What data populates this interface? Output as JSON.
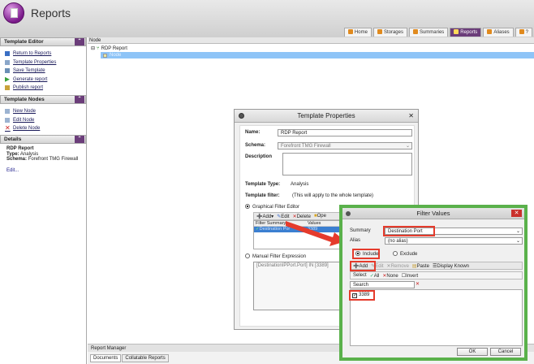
{
  "app": {
    "title": "Reports"
  },
  "nav_tabs": [
    {
      "label": "Home",
      "active": false
    },
    {
      "label": "Storages",
      "active": false
    },
    {
      "label": "Summaries",
      "active": false
    },
    {
      "label": "Reports",
      "active": true
    },
    {
      "label": "Aliases",
      "active": false
    },
    {
      "label": "?",
      "active": false
    }
  ],
  "sidebar": {
    "template_editor": {
      "title": "Template Editor",
      "links": [
        "Return to Reports",
        "Template Properties",
        "Save Template",
        "Generate report",
        "Publish report"
      ]
    },
    "template_nodes": {
      "title": "Template Nodes",
      "links": [
        "New Node",
        "Edit Node",
        "Delete Node"
      ]
    },
    "details": {
      "title": "Details",
      "name": "RDP Report",
      "type_label": "Type:",
      "type_value": "Analysis",
      "schema_label": "Schema:",
      "schema_value": "Forefront TMG Firewall",
      "edit": "Edit..."
    }
  },
  "content": {
    "node_header": "Node",
    "tree_root": "RDP Report",
    "tree_child": "Node"
  },
  "report_manager": {
    "title": "Report Manager",
    "tabs": [
      "Documents",
      "Collatable Reports"
    ]
  },
  "template_properties": {
    "title": "Template Properties",
    "name_label": "Name:",
    "name_value": "RDP Report",
    "schema_label": "Schema:",
    "schema_value": "Forefront TMG Firewall",
    "description_label": "Description",
    "type_label": "Template Type:",
    "type_value": "Analysis",
    "filter_label": "Template filter:",
    "filter_note": "(This will apply to the whole template)",
    "graphical_option": "Graphical Filter Editor",
    "toolbar": {
      "add": "Add",
      "edit": "Edit",
      "delete": "Delete",
      "open": "Ope"
    },
    "table_headers": [
      "Filter Summary",
      "Values"
    ],
    "table_row": {
      "summary": "Destination Por",
      "values": "3389"
    },
    "manual_option": "Manual Filter Expression",
    "manual_expression": "[DestinationIPPort.Port] IN [3389]"
  },
  "filter_values": {
    "title": "Filter Values",
    "summary_label": "Summary",
    "summary_value": "Destination Port",
    "alias_label": "Alias",
    "alias_value": "(no alias)",
    "include": "Include",
    "exclude": "Exclude",
    "toolbar": {
      "add": "Add",
      "edit": "Edit",
      "remove": "Remove",
      "paste": "Paste",
      "display_known": "Display Known"
    },
    "select_bar": {
      "select": "Select",
      "all": "All",
      "none": "None",
      "invert": "Invert"
    },
    "search_placeholder": "Search",
    "items": [
      {
        "label": "3389",
        "checked": true
      }
    ],
    "ok": "OK",
    "cancel": "Cancel"
  },
  "colors": {
    "accent": "#6b3d7a",
    "highlight": "#e53b2c",
    "dialog_border": "#5ab14b",
    "selection": "#3b7fd1"
  }
}
